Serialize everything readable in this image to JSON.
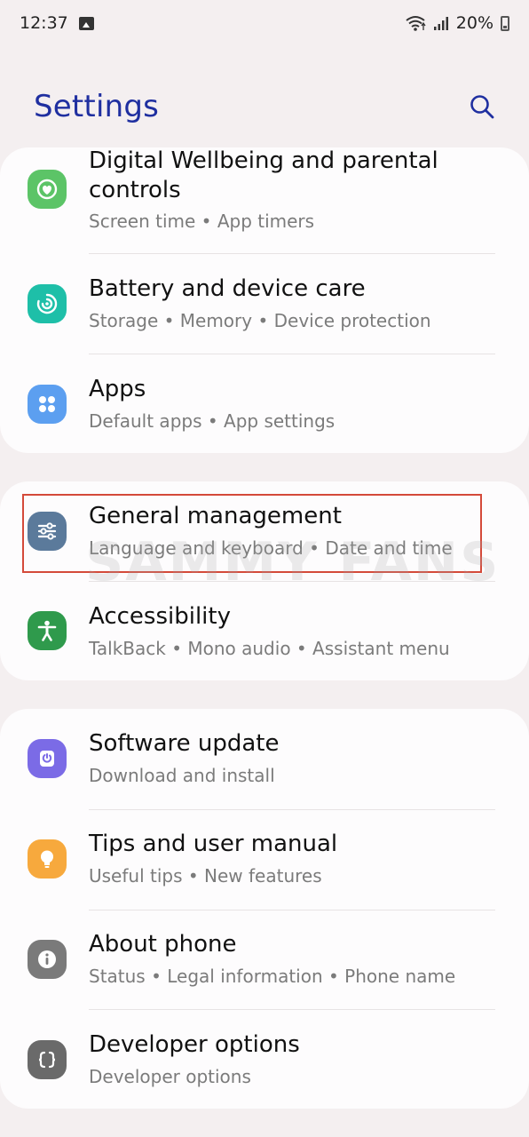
{
  "status_bar": {
    "time": "12:37",
    "battery": "20%"
  },
  "header": {
    "title": "Settings"
  },
  "items": [
    {
      "title_line1": "Digital Wellbeing and parental",
      "title_line2": "controls",
      "subtitle": "Screen time  •  App timers"
    },
    {
      "title": "Battery and device care",
      "subtitle": "Storage  •  Memory  •  Device protection"
    },
    {
      "title": "Apps",
      "subtitle": "Default apps  •  App settings"
    },
    {
      "title": "General management",
      "subtitle": "Language and keyboard  •  Date and time"
    },
    {
      "title": "Accessibility",
      "subtitle": "TalkBack  •  Mono audio  •  Assistant menu"
    },
    {
      "title": "Software update",
      "subtitle": "Download and install"
    },
    {
      "title": "Tips and user manual",
      "subtitle": "Useful tips  •  New features"
    },
    {
      "title": "About phone",
      "subtitle": "Status  •  Legal information  •  Phone name"
    },
    {
      "title": "Developer options",
      "subtitle": "Developer options"
    }
  ],
  "watermark": "SAMMY FANS",
  "colors": {
    "title": "#1f2fa0",
    "digital_wellbeing": "#5cc467",
    "battery": "#1ebfa8",
    "apps": "#5c9ff0",
    "general_management": "#5b7a9b",
    "accessibility": "#2f9a4c",
    "software_update": "#7b6be6",
    "tips": "#f7a93d",
    "about_phone": "#7a7a7a",
    "developer_options": "#6a6a6a",
    "highlight": "#d44a3a"
  }
}
